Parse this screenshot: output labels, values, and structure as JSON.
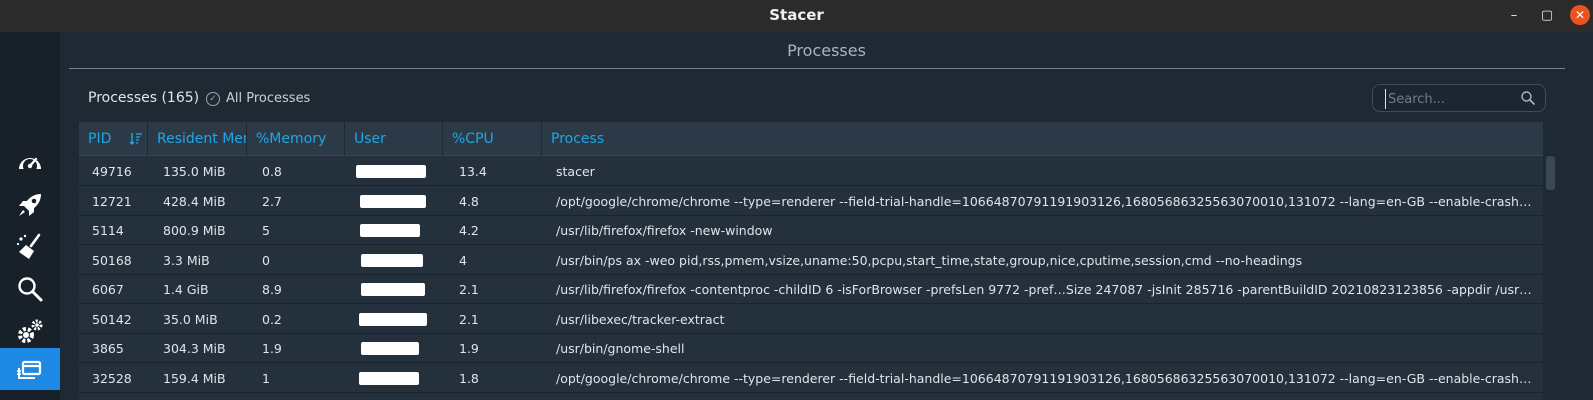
{
  "window": {
    "title": "Stacer",
    "minimize": "–",
    "maximize": "▢",
    "close": "✕"
  },
  "sidebar": {
    "items": [
      {
        "name": "dashboard",
        "icon": "speedometer-icon",
        "active": false
      },
      {
        "name": "startup-apps",
        "icon": "rocket-icon",
        "active": false
      },
      {
        "name": "system-cleaner",
        "icon": "broom-icon",
        "active": false
      },
      {
        "name": "search",
        "icon": "search-icon",
        "active": false
      },
      {
        "name": "services",
        "icon": "gears-icon",
        "active": false
      },
      {
        "name": "processes",
        "icon": "processes-icon",
        "active": true
      }
    ]
  },
  "page": {
    "title": "Processes",
    "count_label": "Processes (165)",
    "all_processes_label": "All Processes",
    "search_placeholder": "Search..."
  },
  "table": {
    "columns": [
      "PID",
      "Resident Memory",
      "%Memory",
      "User",
      "%CPU",
      "Process"
    ],
    "rows": [
      {
        "pid": "49716",
        "rss": "135.0 MiB",
        "mem": "0.8",
        "cpu": "13.4",
        "process": "stacer"
      },
      {
        "pid": "12721",
        "rss": "428.4 MiB",
        "mem": "2.7",
        "cpu": "4.8",
        "process": "/opt/google/chrome/chrome --type=renderer --field-trial-handle=10664870791191903126,16805686325563070010,131072 --lang=en-GB --enable-crashpad --crashpad-handler-pid"
      },
      {
        "pid": "5114",
        "rss": "800.9 MiB",
        "mem": "5",
        "cpu": "4.2",
        "process": "/usr/lib/firefox/firefox -new-window"
      },
      {
        "pid": "50168",
        "rss": "3.3 MiB",
        "mem": "0",
        "cpu": "4",
        "process": "/usr/bin/ps ax -weo pid,rss,pmem,vsize,uname:50,pcpu,start_time,state,group,nice,cputime,session,cmd --no-headings"
      },
      {
        "pid": "6067",
        "rss": "1.4 GiB",
        "mem": "8.9",
        "cpu": "2.1",
        "process": "/usr/lib/firefox/firefox -contentproc -childID 6 -isForBrowser -prefsLen 9772 -pref…Size 247087 -jsInit 285716 -parentBuildID 20210823123856 -appdir /usr/lib/firefox/browser"
      },
      {
        "pid": "50142",
        "rss": "35.0 MiB",
        "mem": "0.2",
        "cpu": "2.1",
        "process": "/usr/libexec/tracker-extract"
      },
      {
        "pid": "3865",
        "rss": "304.3 MiB",
        "mem": "1.9",
        "cpu": "1.9",
        "process": "/usr/bin/gnome-shell"
      },
      {
        "pid": "32528",
        "rss": "159.4 MiB",
        "mem": "1",
        "cpu": "1.8",
        "process": "/opt/google/chrome/chrome --type=renderer --field-trial-handle=10664870791191903126,16805686325563070010,131072 --lang=en-GB --enable-crashpad --crashpad-handler-pid"
      }
    ]
  },
  "colors": {
    "accent": "#1e88e5",
    "header_text": "#1ea6e6",
    "close_button": "#e95420"
  }
}
